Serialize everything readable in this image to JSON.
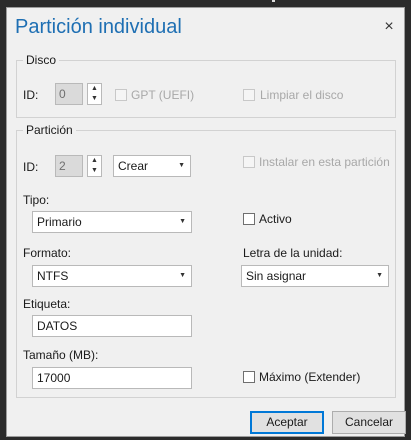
{
  "dialog": {
    "title": "Partición individual",
    "close_glyph": "×"
  },
  "disco": {
    "legend": "Disco",
    "id_label": "ID:",
    "id_value": "0",
    "gpt_label": "GPT (UEFI)",
    "limpiar_label": "Limpiar el disco"
  },
  "particion": {
    "legend": "Partición",
    "id_label": "ID:",
    "id_value": "2",
    "action_value": "Crear",
    "instalar_label": "Instalar en esta partición",
    "tipo_label": "Tipo:",
    "tipo_value": "Primario",
    "activo_label": "Activo",
    "formato_label": "Formato:",
    "formato_value": "NTFS",
    "letra_label": "Letra de la unidad:",
    "letra_value": "Sin asignar",
    "etiqueta_label": "Etiqueta:",
    "etiqueta_value": "DATOS",
    "tamano_label": "Tamaño (MB):",
    "tamano_value": "17000",
    "maximo_label": "Máximo (Extender)"
  },
  "buttons": {
    "accept": "Aceptar",
    "cancel": "Cancelar"
  },
  "icons": {
    "spin_up": "▲",
    "spin_down": "▼",
    "dropdown": "▼"
  }
}
